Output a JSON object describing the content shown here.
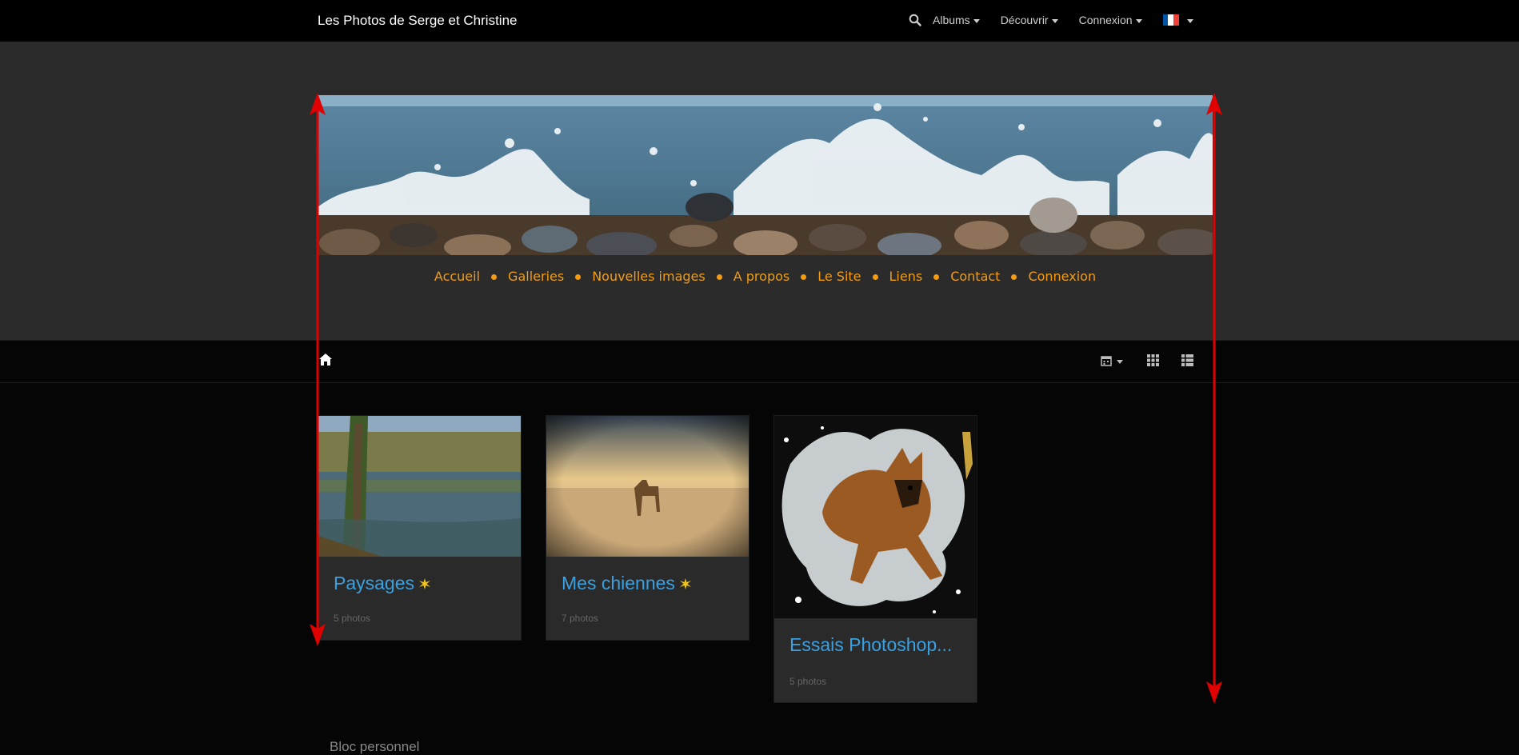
{
  "topbar": {
    "title": "Les Photos de Serge et Christine",
    "menus": [
      "Albums",
      "Découvrir",
      "Connexion"
    ],
    "language_flag": [
      "#0055a4",
      "#ffffff",
      "#ef4135"
    ]
  },
  "site_nav": {
    "items": [
      "Accueil",
      "Galleries",
      "Nouvelles images",
      "A propos",
      "Le Site",
      "Liens",
      "Contact",
      "Connexion"
    ]
  },
  "albums": [
    {
      "title": "Paysages",
      "count": "5 photos",
      "new": true
    },
    {
      "title": "Mes chiennes",
      "count": "7 photos",
      "new": true
    },
    {
      "title": "Essais Photoshop...",
      "count": "5 photos",
      "new": false
    }
  ],
  "footer": {
    "bloc": "Bloc personnel"
  },
  "colors": {
    "accent_orange": "#f39c12",
    "link_blue": "#3aa0e0",
    "annotation_red": "#e00000"
  }
}
